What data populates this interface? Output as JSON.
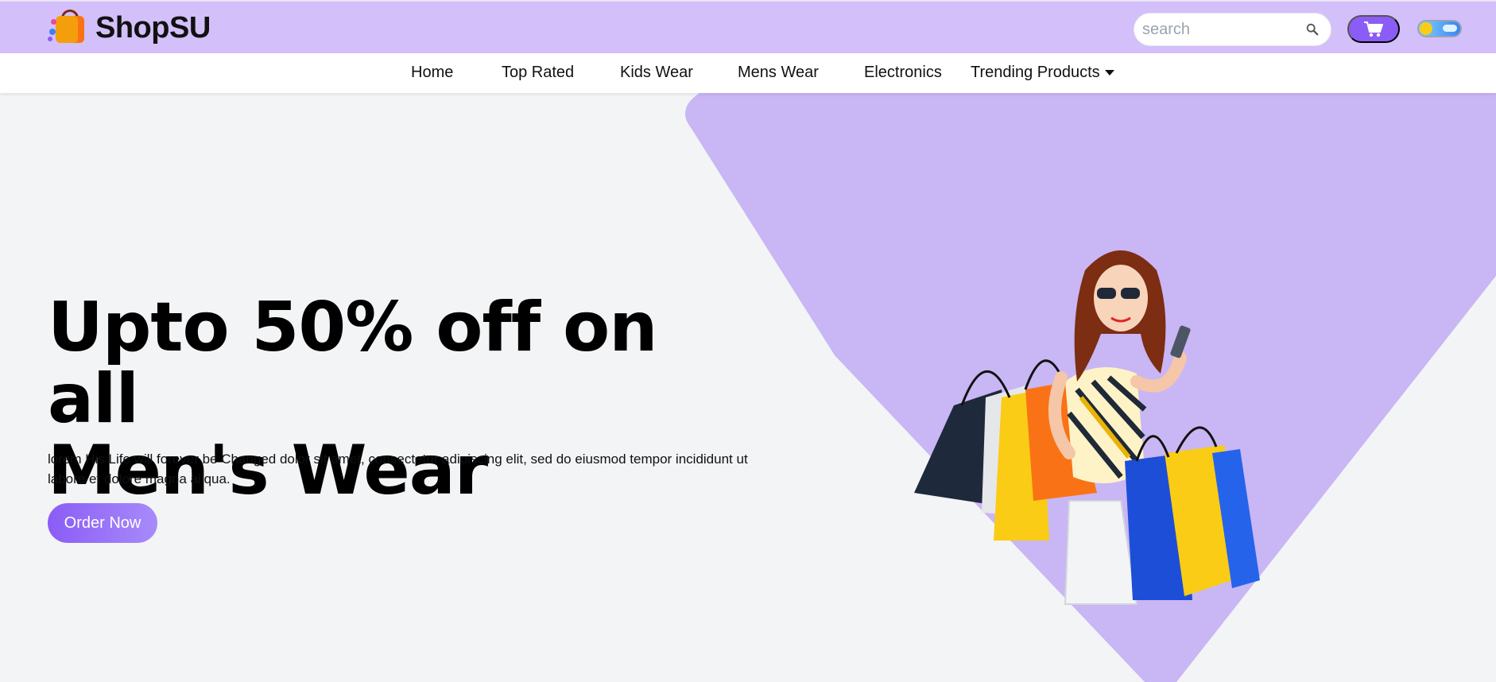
{
  "brand": {
    "name": "ShopSU"
  },
  "search": {
    "placeholder": "search"
  },
  "nav": {
    "items": [
      {
        "label": "Home"
      },
      {
        "label": "Top Rated"
      },
      {
        "label": "Kids Wear"
      },
      {
        "label": "Mens Wear"
      },
      {
        "label": "Electronics"
      },
      {
        "label": "Trending Products"
      }
    ]
  },
  "hero": {
    "headline_line1": "Upto 50% off on all",
    "headline_line2": "Men's Wear",
    "description": "lorem His Life will forever be Changed dolor sit amet, consectetur adipiscing elit, sed do eiusmod tempor incididunt ut labore et dolore magna aliqua.",
    "cta_label": "Order Now"
  },
  "colors": {
    "topbar": "#d3bff9",
    "accent": "#8b5cf6",
    "hero_shape": "#c9b6f5",
    "page_bg": "#f3f4f6"
  },
  "icons": {
    "search": "search-icon",
    "cart": "cart-icon",
    "theme_toggle": "theme-toggle-icon",
    "dropdown": "caret-down-icon"
  }
}
